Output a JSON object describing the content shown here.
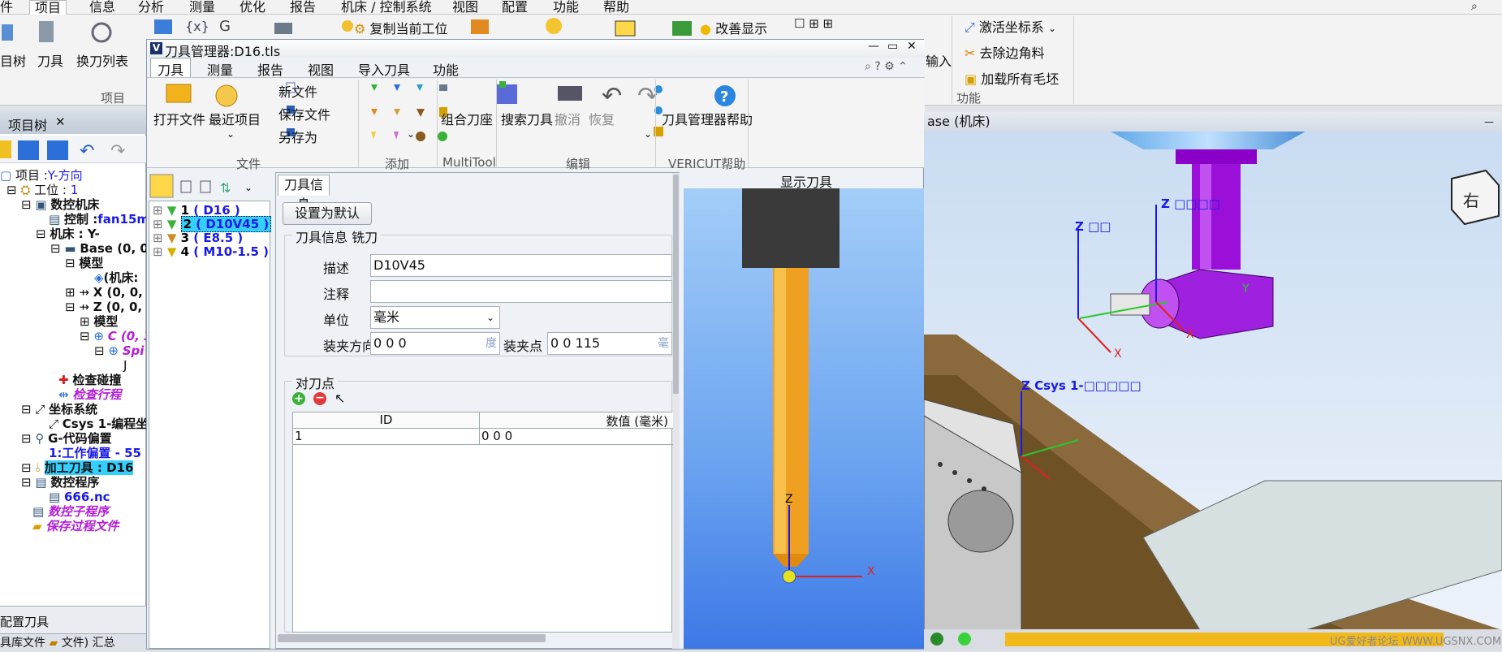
{
  "app_menu": [
    "件",
    "项目",
    "信息",
    "分析",
    "测量",
    "优化",
    "报告",
    "机床 / 控制系统",
    "视图",
    "配置",
    "功能",
    "帮助"
  ],
  "app_menu_active": "项目",
  "app_ribbon": {
    "left_labels": [
      "目树",
      "刀具",
      "换刀列表"
    ],
    "group_project": "项目",
    "copy_station": "复制当前工位",
    "improve_display": "改善显示",
    "input": "输入",
    "func_items": [
      "激活坐标系",
      "去除边角料",
      "加载所有毛坯"
    ],
    "group_function": "功能"
  },
  "project_tree": {
    "tab": "项目树",
    "rows": [
      {
        "text": "项目 :",
        "extra": "Y-方向",
        "style": "extra-blue"
      },
      {
        "text": "工位 :",
        "extra": "1",
        "style": "extra-blue"
      },
      {
        "text": "数控机床",
        "extra": "",
        "style": "bold"
      },
      {
        "text": "控制 :",
        "extra": "fan15m",
        "style": "extra-blue"
      },
      {
        "text": "机床 : Y-",
        "extra": "",
        "style": "blue"
      },
      {
        "text": "Base (0, 0,",
        "extra": "",
        "style": "bold"
      },
      {
        "text": "模型",
        "extra": "",
        "style": "bold"
      },
      {
        "text": "(机床:",
        "extra": "",
        "style": "bold"
      },
      {
        "text": "X (0, 0, 0",
        "extra": "",
        "style": "bold"
      },
      {
        "text": "Z (0, 0, 0",
        "extra": "",
        "style": "bold"
      },
      {
        "text": "模型",
        "extra": "",
        "style": "bold"
      },
      {
        "text": "C (0, 3",
        "extra": "",
        "style": "purple"
      },
      {
        "text": "Spi",
        "extra": "",
        "style": "purple"
      },
      {
        "text": "J",
        "extra": "",
        "style": "plain"
      },
      {
        "text": "检查碰撞",
        "extra": "",
        "style": "bold"
      },
      {
        "text": "检查行程",
        "extra": "",
        "style": "purple"
      },
      {
        "text": "坐标系统",
        "extra": "",
        "style": "bold"
      },
      {
        "text": "Csys 1-编程坐",
        "extra": "",
        "style": "bold"
      },
      {
        "text": "G-代码偏置",
        "extra": "",
        "style": "bold"
      },
      {
        "text": "1:工作偏置 - 55",
        "extra": "",
        "style": "blue"
      },
      {
        "text": "加工刀具 : D16",
        "extra": "",
        "style": "hl"
      },
      {
        "text": "数控程序",
        "extra": "",
        "style": "bold"
      },
      {
        "text": "666.nc",
        "extra": "",
        "style": "blue"
      },
      {
        "text": "数控子程序",
        "extra": "",
        "style": "purple"
      },
      {
        "text": "保存过程文件",
        "extra": "",
        "style": "purple"
      }
    ]
  },
  "bottom_left": {
    "config_tool": "配置刀具",
    "tabs": [
      "具库文件",
      "文件)",
      "汇总"
    ],
    "coord": "坐标系统"
  },
  "tool_manager": {
    "title": "刀具管理器:D16.tls",
    "menu": [
      "刀具",
      "测量",
      "报告",
      "视图",
      "导入刀具",
      "功能"
    ],
    "menu_active": "刀具",
    "ribbon": {
      "open_file": "打开文件",
      "recent": "最近项目",
      "new_file": "新文件",
      "save_file": "保存文件",
      "save_as": "另存为",
      "group_file": "文件",
      "group_add": "添加",
      "combo_holder": "组合刀座",
      "group_multitool": "MultiTool",
      "search_tool": "搜索刀具",
      "undo": "撤消",
      "redo": "恢复",
      "group_edit": "编辑",
      "help": "刀具管理器帮助",
      "group_help": "VERICUT帮助"
    },
    "tool_list": [
      {
        "id": "1",
        "name": "( D16 )",
        "selected": false
      },
      {
        "id": "2",
        "name": "( D10V45 )",
        "selected": true
      },
      {
        "id": "3",
        "name": "( E8.5 )",
        "selected": false
      },
      {
        "id": "4",
        "name": "( M10-1.5 )",
        "selected": false
      }
    ],
    "info_tab": "刀具信息",
    "set_default": "设置为默认",
    "section_title": "刀具信息 铣刀",
    "desc_label": "描述",
    "desc_value": "D10V45",
    "note_label": "注释",
    "note_value": "",
    "unit_label": "单位",
    "unit_value": "毫米",
    "clamp_dir_label": "装夹方向",
    "clamp_dir_value": "0 0 0",
    "clamp_dir_unit": "度",
    "clamp_pt_label": "装夹点",
    "clamp_pt_value": "0 0 115",
    "clamp_pt_unit": "毫",
    "gauge_title": "对刀点",
    "table_headers": [
      "ID",
      "数值 (毫米)"
    ],
    "table_rows": [
      [
        "1",
        "0 0 0"
      ]
    ],
    "preview_title": "显示刀具",
    "axis_z": "Z",
    "axis_x": "X"
  },
  "view3d": {
    "title": "ase (机床)",
    "labels": {
      "z_top": "Z □□□□",
      "z_mid": "Z □□",
      "csys": "Z Csys 1-□□□□□",
      "x": "X",
      "y": "Y"
    },
    "cube_face": "右",
    "watermark": "UG爱好者论坛 WWW.UGSNX.COM"
  }
}
